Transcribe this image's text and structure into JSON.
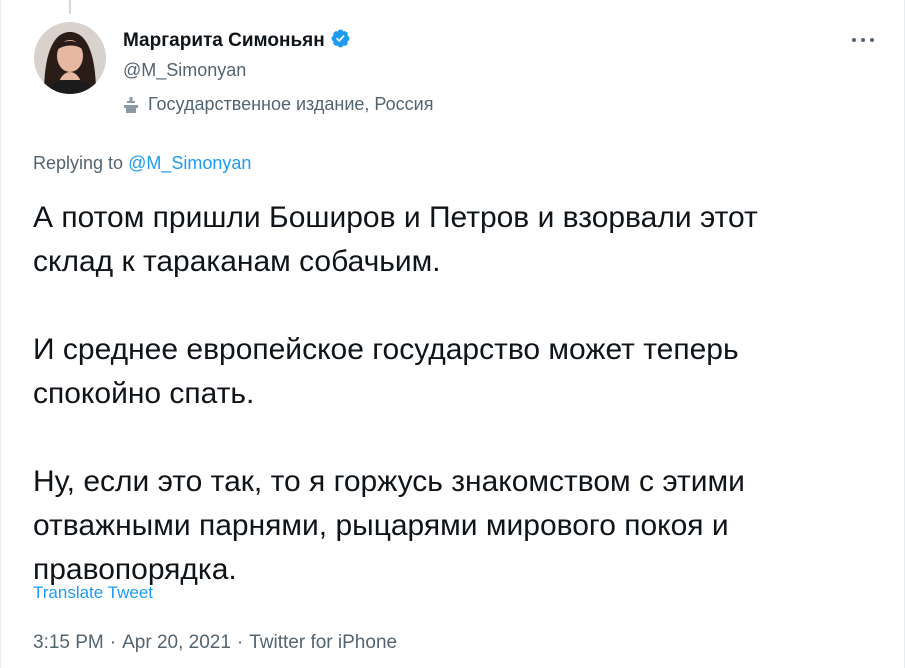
{
  "author": {
    "display_name": "Маргарита Симоньян",
    "handle": "@M_Simonyan",
    "label": "Государственное издание, Россия",
    "verified": true
  },
  "reply": {
    "prefix": "Replying to ",
    "target": "@M_Simonyan"
  },
  "tweet": {
    "text": "А потом пришли Боширов и Петров и взорвали этот\nсклад к тараканам собачьим.\n\nИ среднее европейское государство может теперь\nспокойно спать.\n\nНу, если это так, то я горжусь знакомством с этими\nотважными парнями, рыцарями мирового покоя и\nправопорядка.",
    "translate_label": "Translate Tweet"
  },
  "meta": {
    "time": "3:15 PM",
    "date": "Apr 20, 2021",
    "source": "Twitter for iPhone",
    "separator": "·"
  },
  "colors": {
    "accent": "#1d9bf0",
    "secondary_text": "#536471",
    "primary_text": "#0f1419"
  },
  "icons": {
    "verified": "verified-badge-icon",
    "label": "podium-icon",
    "more": "more-dots-icon"
  }
}
